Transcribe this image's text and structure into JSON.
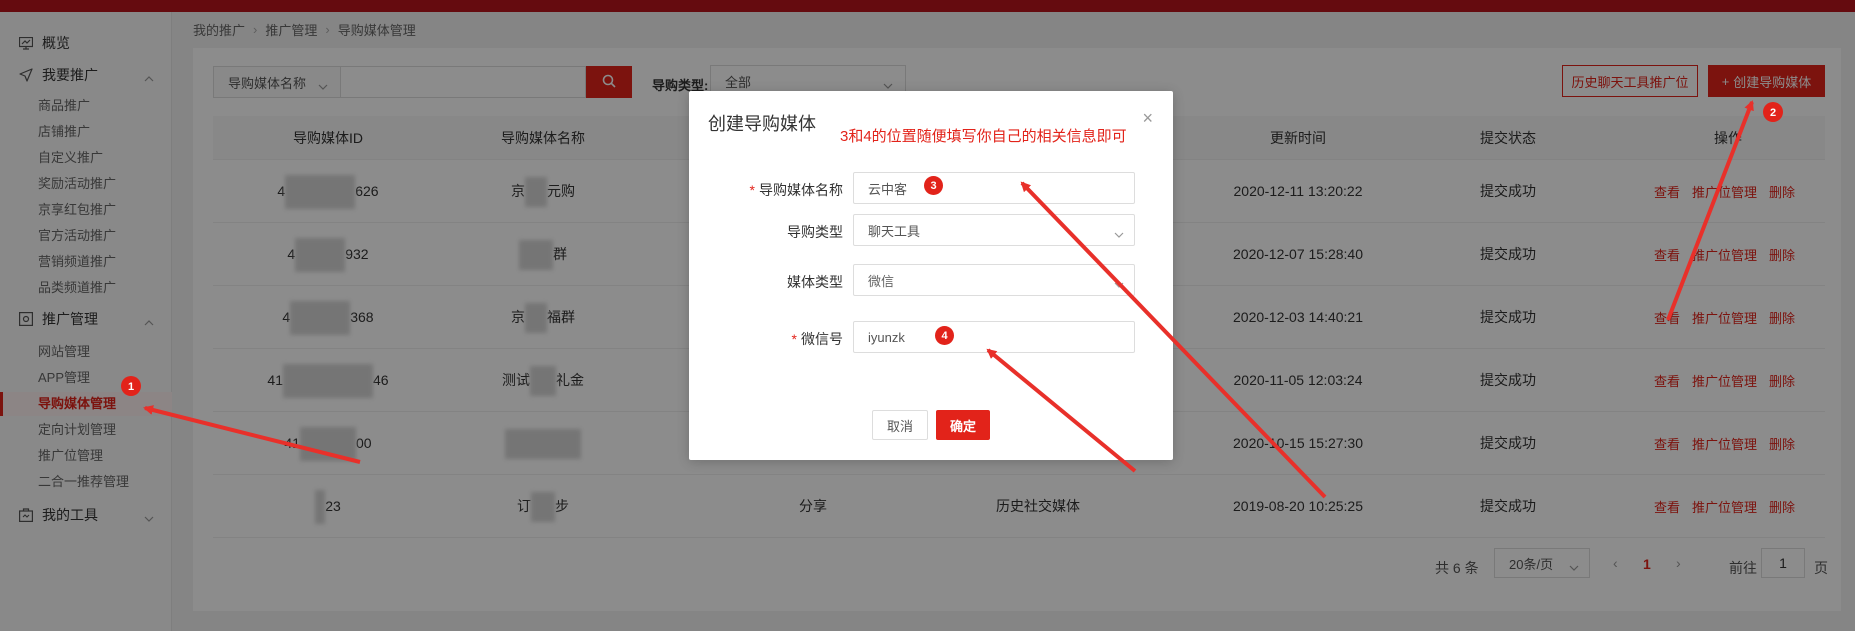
{
  "sidebar": {
    "overview": "概览",
    "promote_group": "我要推广",
    "promote_items": [
      "商品推广",
      "店铺推广",
      "自定义推广",
      "奖励活动推广",
      "京享红包推广",
      "官方活动推广",
      "营销频道推广",
      "品类频道推广"
    ],
    "manage_group": "推广管理",
    "manage_items": [
      "网站管理",
      "APP管理",
      "导购媒体管理",
      "定向计划管理",
      "推广位管理",
      "二合一推荐管理"
    ],
    "tools_group": "我的工具"
  },
  "breadcrumb": [
    "我的推广",
    "推广管理",
    "导购媒体管理"
  ],
  "toolbar": {
    "search_field": "导购媒体名称",
    "search_value": "",
    "type_label": "导购类型:",
    "type_value": "全部",
    "history_button": "历史聊天工具推广位",
    "create_button": "创建导购媒体",
    "create_plus": "+"
  },
  "table": {
    "headers": [
      "导购媒体ID",
      "导购媒体名称",
      "更新时间",
      "提交状态",
      "操作"
    ],
    "rows": [
      {
        "id_start": "4",
        "id_end": "626",
        "name_start": "京",
        "name_end": "元购",
        "col3": "",
        "col4": "",
        "time": "2020-12-11 13:20:22",
        "status": "提交成功"
      },
      {
        "id_start": "4",
        "id_end": "932",
        "name_start": "",
        "name_end": "群",
        "col3": "",
        "col4": "",
        "time": "2020-12-07 15:28:40",
        "status": "提交成功"
      },
      {
        "id_start": "4",
        "id_end": "368",
        "name_start": "京",
        "name_end": "福群",
        "col3": "",
        "col4": "",
        "time": "2020-12-03 14:40:21",
        "status": "提交成功"
      },
      {
        "id_start": "41",
        "id_end": "46",
        "name_start": "测试",
        "name_end": "礼金",
        "col3": "",
        "col4": "",
        "time": "2020-11-05 12:03:24",
        "status": "提交成功"
      },
      {
        "id_start": "41",
        "id_end": "00",
        "name_start": "",
        "name_end": "",
        "col3": "",
        "col4": "",
        "time": "2020-10-15 15:27:30",
        "status": "提交成功"
      },
      {
        "id_start": "",
        "id_end": "23",
        "name_start": "订",
        "name_end": "步",
        "col3": "分享",
        "col4": "历史社交媒体",
        "time": "2019-08-20 10:25:25",
        "status": "提交成功"
      }
    ],
    "actions": [
      "查看",
      "推广位管理",
      "删除"
    ]
  },
  "pagination": {
    "total": "共 6 条",
    "page_size": "20条/页",
    "current_page": "1",
    "goto_label": "前往",
    "goto_value": "1",
    "page_suffix": "页",
    "prev": "‹",
    "next": "›"
  },
  "modal": {
    "title": "创建导购媒体",
    "note": "3和4的位置随便填写你自己的相关信息即可",
    "close": "×",
    "fields": [
      {
        "label": "导购媒体名称",
        "required": true,
        "value": "云中客",
        "badge": "3"
      },
      {
        "label": "导购类型",
        "required": false,
        "value": "聊天工具"
      },
      {
        "label": "媒体类型",
        "required": false,
        "value": "微信"
      },
      {
        "label": "微信号",
        "required": true,
        "value": "iyunzk",
        "badge": "4"
      }
    ],
    "cancel": "取消",
    "ok": "确定"
  },
  "annotations": {
    "badge1": "1",
    "badge2": "2",
    "arrow_color": "#e8302a"
  },
  "colors": {
    "brand": "#e2231a",
    "topbar": "#b8141c"
  }
}
